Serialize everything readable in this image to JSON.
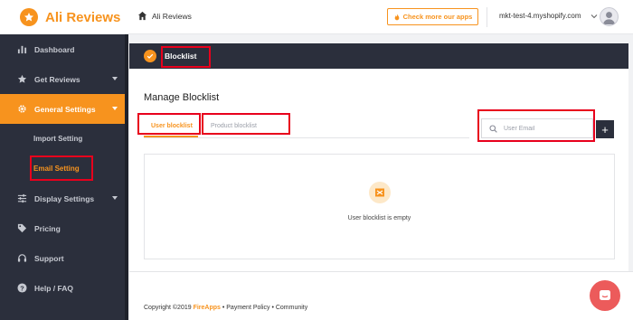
{
  "app": {
    "brand": "Ali Reviews",
    "brand_color": "#f7931e",
    "sidebar_color": "#2b2f3c"
  },
  "sidebar": {
    "items": [
      {
        "label": "Dashboard",
        "icon": "bar-chart-icon"
      },
      {
        "label": "Get Reviews",
        "icon": "star-icon"
      },
      {
        "label": "General Settings",
        "icon": "gear-icon",
        "active": true
      },
      {
        "label": "Display Settings",
        "icon": "sliders-icon"
      },
      {
        "label": "Pricing",
        "icon": "tag-icon"
      },
      {
        "label": "Support",
        "icon": "headset-icon"
      },
      {
        "label": "Help / FAQ",
        "icon": "question-icon"
      }
    ],
    "sub_items": [
      {
        "label": "Import Setting"
      },
      {
        "label": "Email Setting",
        "current": true
      }
    ]
  },
  "topbar": {
    "breadcrumb": "Ali Reviews",
    "check_button": "Check more our apps",
    "shop": "mkt-test-4.myshopify.com"
  },
  "page": {
    "section_title": "Blocklist",
    "heading": "Manage Blocklist",
    "tabs": [
      {
        "label": "User blocklist",
        "active": true
      },
      {
        "label": "Product blocklist"
      }
    ],
    "search_placeholder": "User Email",
    "add_label": "+",
    "empty_text": "User blocklist is empty"
  },
  "footer": {
    "prefix": "Copyright ©2019 ",
    "brand": "FireApps",
    "suffix": " • Payment Policy • Community"
  }
}
